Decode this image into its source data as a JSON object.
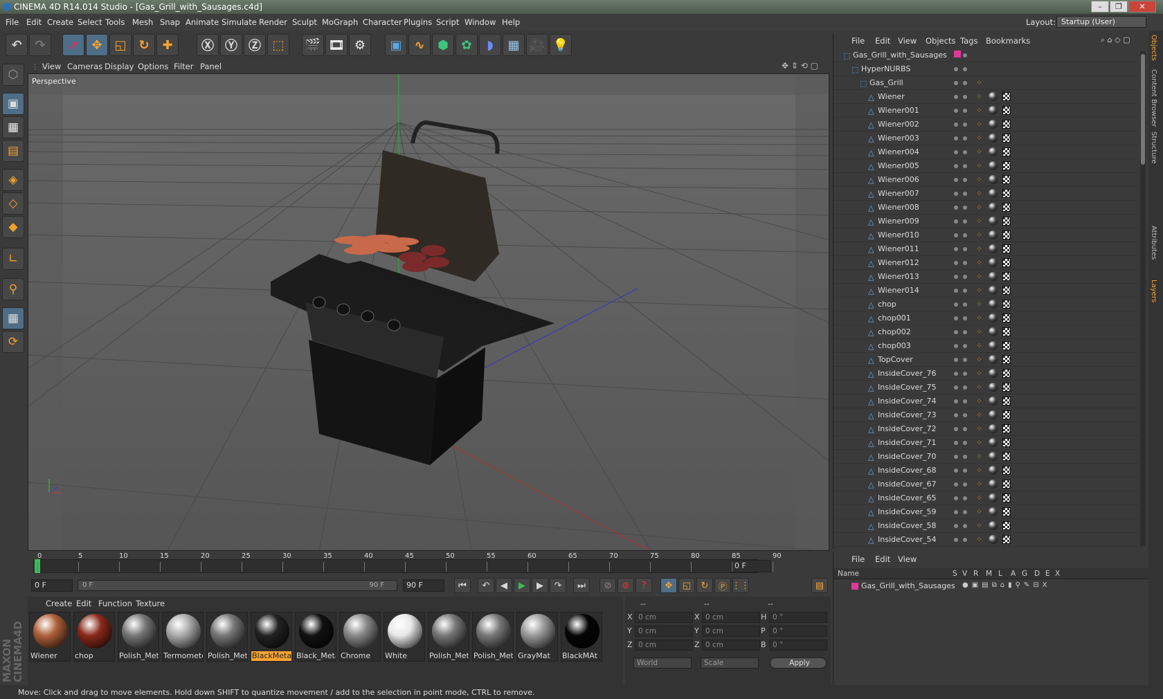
{
  "window": {
    "title": "CINEMA 4D R14.014 Studio - [Gas_Grill_with_Sausages.c4d]"
  },
  "menu": [
    "File",
    "Edit",
    "Create",
    "Select",
    "Tools",
    "Mesh",
    "Snap",
    "Animate",
    "Simulate",
    "Render",
    "Sculpt",
    "MoGraph",
    "Character",
    "Plugins",
    "Script",
    "Window",
    "Help"
  ],
  "layout": {
    "label": "Layout:",
    "value": "Startup (User)"
  },
  "viewport": {
    "menu": [
      "View",
      "Cameras",
      "Display",
      "Options",
      "Filter",
      "Panel"
    ],
    "label": "Perspective"
  },
  "timeline": {
    "ticks": [
      "0",
      "5",
      "10",
      "15",
      "20",
      "25",
      "30",
      "35",
      "40",
      "45",
      "50",
      "55",
      "60",
      "65",
      "70",
      "75",
      "80",
      "85",
      "90"
    ],
    "current": "0 F"
  },
  "controls": {
    "start": "0 F",
    "range_start": "0 F",
    "range_end": "90 F",
    "end": "90 F"
  },
  "materials": {
    "menu": [
      "Create",
      "Edit",
      "Function",
      "Texture"
    ],
    "items": [
      {
        "name": "Wiener",
        "color": "#b0603a"
      },
      {
        "name": "chop",
        "color": "#8a2a1a"
      },
      {
        "name": "Polish_Met",
        "color": "#777"
      },
      {
        "name": "Termomete",
        "color": "#aaa"
      },
      {
        "name": "Polish_Met",
        "color": "#777"
      },
      {
        "name": "BlackMetal",
        "color": "#222"
      },
      {
        "name": "Black_Meta",
        "color": "#111"
      },
      {
        "name": "Chrome",
        "color": "#888"
      },
      {
        "name": "White",
        "color": "#e8e8e8"
      },
      {
        "name": "Polish_Met",
        "color": "#777"
      },
      {
        "name": "Polish_Met",
        "color": "#777"
      },
      {
        "name": "GrayMat",
        "color": "#999"
      },
      {
        "name": "BlackMAt",
        "color": "#050505"
      }
    ],
    "selected": "BlackMetal"
  },
  "coords": {
    "header": [
      "--",
      "--",
      "--"
    ],
    "rows": [
      {
        "a": "X",
        "av": "0 cm",
        "b": "X",
        "bv": "0 cm",
        "c": "H",
        "cv": "0 °"
      },
      {
        "a": "Y",
        "av": "0 cm",
        "b": "Y",
        "bv": "0 cm",
        "c": "P",
        "cv": "0 °"
      },
      {
        "a": "Z",
        "av": "0 cm",
        "b": "Z",
        "bv": "0 cm",
        "c": "B",
        "cv": "0 °"
      }
    ],
    "world": "World",
    "scale": "Scale",
    "apply": "Apply"
  },
  "status": "Move: Click and drag to move elements. Hold down SHIFT to quantize movement / add to the selection in point mode, CTRL to remove.",
  "objects": {
    "menu": [
      "File",
      "Edit",
      "View",
      "Objects",
      "Tags",
      "Bookmarks"
    ],
    "rows": [
      {
        "name": "Gas_Grill_with_Sausages",
        "indent": 0
      },
      {
        "name": "HyperNURBS",
        "indent": 1
      },
      {
        "name": "Gas_Grill",
        "indent": 2
      },
      {
        "name": "Wiener",
        "indent": 3
      },
      {
        "name": "Wiener001",
        "indent": 3
      },
      {
        "name": "Wiener002",
        "indent": 3
      },
      {
        "name": "Wiener003",
        "indent": 3
      },
      {
        "name": "Wiener004",
        "indent": 3
      },
      {
        "name": "Wiener005",
        "indent": 3
      },
      {
        "name": "Wiener006",
        "indent": 3
      },
      {
        "name": "Wiener007",
        "indent": 3
      },
      {
        "name": "Wiener008",
        "indent": 3
      },
      {
        "name": "Wiener009",
        "indent": 3
      },
      {
        "name": "Wiener010",
        "indent": 3
      },
      {
        "name": "Wiener011",
        "indent": 3
      },
      {
        "name": "Wiener012",
        "indent": 3
      },
      {
        "name": "Wiener013",
        "indent": 3
      },
      {
        "name": "Wiener014",
        "indent": 3
      },
      {
        "name": "chop",
        "indent": 3
      },
      {
        "name": "chop001",
        "indent": 3
      },
      {
        "name": "chop002",
        "indent": 3
      },
      {
        "name": "chop003",
        "indent": 3
      },
      {
        "name": "TopCover",
        "indent": 3
      },
      {
        "name": "InsideCover_76",
        "indent": 3
      },
      {
        "name": "InsideCover_75",
        "indent": 3
      },
      {
        "name": "InsideCover_74",
        "indent": 3
      },
      {
        "name": "InsideCover_73",
        "indent": 3
      },
      {
        "name": "InsideCover_72",
        "indent": 3
      },
      {
        "name": "InsideCover_71",
        "indent": 3
      },
      {
        "name": "InsideCover_70",
        "indent": 3
      },
      {
        "name": "InsideCover_68",
        "indent": 3
      },
      {
        "name": "InsideCover_67",
        "indent": 3
      },
      {
        "name": "InsideCover_65",
        "indent": 3
      },
      {
        "name": "InsideCover_59",
        "indent": 3
      },
      {
        "name": "InsideCover_58",
        "indent": 3
      },
      {
        "name": "InsideCover_54",
        "indent": 3
      }
    ]
  },
  "attributes": {
    "menu": [
      "File",
      "Edit",
      "View"
    ],
    "columns": [
      "Name",
      "S",
      "V",
      "R",
      "M",
      "L",
      "A",
      "G",
      "D",
      "E",
      "X"
    ],
    "row": "Gas_Grill_with_Sausages"
  },
  "side_tabs": [
    "Objects",
    "Content Browser",
    "Structure",
    "Attributes",
    "Layers"
  ],
  "colors": {
    "accent": "#f7a430",
    "selected_blue": "#4e6d86",
    "layer_pink": "#e0399a"
  }
}
